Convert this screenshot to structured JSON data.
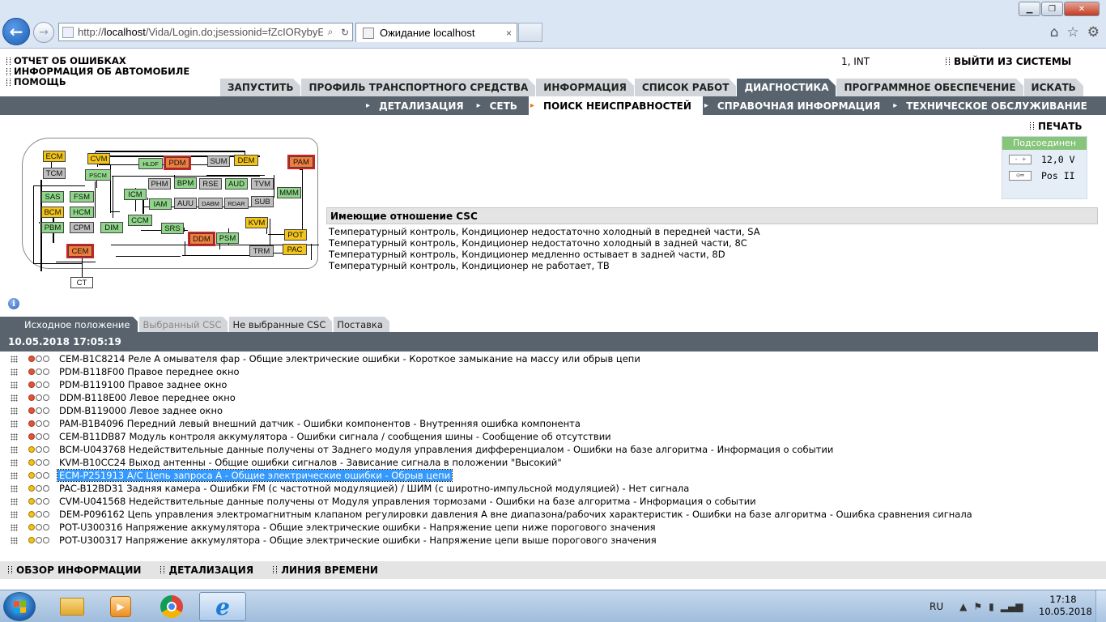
{
  "browser": {
    "url_prefix": "http://",
    "url_host": "localhost",
    "url_rest": "/Vida/Login.do;jsessionid=fZcIORybyE",
    "tab_title": "Ожидание localhost",
    "tab_close": "×"
  },
  "header": {
    "links": [
      "ОТЧЕТ ОБ ОШИБКАХ",
      "ИНФОРМАЦИЯ ОБ АВТОМОБИЛЕ",
      "ПОМОЩЬ"
    ],
    "user": "1, INT",
    "logout": "ВЫЙТИ ИЗ СИСТЕМЫ"
  },
  "main_tabs": [
    {
      "label": "ЗАПУСТИТЬ",
      "active": false
    },
    {
      "label": "ПРОФИЛЬ ТРАНСПОРТНОГО СРЕДСТВА",
      "active": false
    },
    {
      "label": "ИНФОРМАЦИЯ",
      "active": false
    },
    {
      "label": "СПИСОК РАБОТ",
      "active": false
    },
    {
      "label": "ДИАГНОСТИКА",
      "active": true
    },
    {
      "label": "ПРОГРАММНОЕ ОБЕСПЕЧЕНИЕ",
      "active": false
    },
    {
      "label": "ИСКАТЬ",
      "active": false
    }
  ],
  "sub_tabs": [
    {
      "label": "ДЕТАЛИЗАЦИЯ",
      "active": false
    },
    {
      "label": "СЕТЬ",
      "active": false
    },
    {
      "label": "ПОИСК НЕИСПРАВНОСТЕЙ",
      "active": true
    },
    {
      "label": "СПРАВОЧНАЯ ИНФОРМАЦИЯ",
      "active": false
    },
    {
      "label": "ТЕХНИЧЕСКОЕ ОБСЛУЖИВАНИЕ",
      "active": false
    }
  ],
  "print_label": "ПЕЧАТЬ",
  "status": {
    "header": "Подсоединен",
    "voltage": "12,0 V",
    "position": "Pos II",
    "status_color": "#86c57a"
  },
  "diagram": {
    "nodes": [
      {
        "label": "ECM",
        "color": "yellow"
      },
      {
        "label": "TCM",
        "color": "gray"
      },
      {
        "label": "CVM",
        "color": "yellow"
      },
      {
        "label": "PSCM",
        "color": "green"
      },
      {
        "label": "HLDF",
        "color": "green"
      },
      {
        "label": "PDM",
        "color": "red"
      },
      {
        "label": "SUM",
        "color": "gray"
      },
      {
        "label": "DEM",
        "color": "yellow"
      },
      {
        "label": "PAM",
        "color": "red"
      },
      {
        "label": "SAS",
        "color": "green"
      },
      {
        "label": "FSM",
        "color": "green"
      },
      {
        "label": "BCM",
        "color": "yellow"
      },
      {
        "label": "HCM",
        "color": "green"
      },
      {
        "label": "PBM",
        "color": "green"
      },
      {
        "label": "CPM",
        "color": "gray"
      },
      {
        "label": "ICM",
        "color": "green"
      },
      {
        "label": "PHM",
        "color": "gray"
      },
      {
        "label": "BPM",
        "color": "green"
      },
      {
        "label": "RSE",
        "color": "gray"
      },
      {
        "label": "AUD",
        "color": "green"
      },
      {
        "label": "TVM",
        "color": "gray"
      },
      {
        "label": "MMM",
        "color": "green"
      },
      {
        "label": "IAM",
        "color": "green"
      },
      {
        "label": "AUU",
        "color": "gray"
      },
      {
        "label": "DABM",
        "color": "gray"
      },
      {
        "label": "RDAR",
        "color": "gray"
      },
      {
        "label": "SUB",
        "color": "gray"
      },
      {
        "label": "DIM",
        "color": "green"
      },
      {
        "label": "CCM",
        "color": "green"
      },
      {
        "label": "SRS",
        "color": "green"
      },
      {
        "label": "KVM",
        "color": "yellow"
      },
      {
        "label": "POT",
        "color": "yellow"
      },
      {
        "label": "DDM",
        "color": "red"
      },
      {
        "label": "PSM",
        "color": "green"
      },
      {
        "label": "CEM",
        "color": "red"
      },
      {
        "label": "TRM",
        "color": "gray"
      },
      {
        "label": "PAC",
        "color": "yellow"
      },
      {
        "label": "CT",
        "color": "white"
      }
    ]
  },
  "csc": {
    "title": "Имеющие отношение CSC",
    "items": [
      "Температурный контроль, Кондиционер недостаточно холодный в передней части, SA",
      "Температурный контроль, Кондиционер недостаточно холодный в задней части, 8C",
      "Температурный контроль, Кондиционер медленно остывает в задней части, 8D",
      "Температурный контроль, Кондиционер не работает, TB"
    ]
  },
  "result_tabs": [
    {
      "label": "Исходное положение",
      "state": "active"
    },
    {
      "label": "Выбранный CSC",
      "state": "dim"
    },
    {
      "label": "Не выбранные CSC",
      "state": "normal"
    },
    {
      "label": "Поставка",
      "state": "normal"
    }
  ],
  "timestamp": "10.05.2018 17:05:19",
  "dtcs": [
    {
      "lamp": "red",
      "text": "CEM-B1C8214 Реле А омывателя фар - Общие электрические ошибки - Короткое замыкание на массу или обрыв цепи"
    },
    {
      "lamp": "red",
      "text": "PDM-B118F00 Правое переднее окно"
    },
    {
      "lamp": "red",
      "text": "PDM-B119100 Правое заднее окно"
    },
    {
      "lamp": "red",
      "text": "DDM-B118E00 Левое переднее окно"
    },
    {
      "lamp": "red",
      "text": "DDM-B119000 Левое заднее окно"
    },
    {
      "lamp": "red",
      "text": "PAM-B1B4096 Передний левый внешний датчик - Ошибки компонентов - Внутренняя ошибка компонента"
    },
    {
      "lamp": "red",
      "text": "CEM-B11DB87 Модуль контроля аккумулятора - Ошибки сигнала / сообщения шины - Сообщение об отсутствии"
    },
    {
      "lamp": "yellow",
      "text": "BCM-U043768 Недействительные данные получены от Заднего модуля управления дифференциалом - Ошибки на базе алгоритма - Информация о событии"
    },
    {
      "lamp": "yellow",
      "text": "KVM-B10CC24 Выход антенны - Общие ошибки сигналов - Зависание сигнала в положении \"Высокий\""
    },
    {
      "lamp": "yellow",
      "text": "ECM-P251913 A/C Цепь запроса A - Общие электрические ошибки - Обрыв цепи",
      "selected": true
    },
    {
      "lamp": "yellow",
      "text": "PAC-B12BD31 Задняя камера - Ошибки FM (с частотной модуляцией) / ШИМ (с широтно-импульсной модуляцией) - Нет сигнала"
    },
    {
      "lamp": "yellow",
      "text": "CVM-U041568 Недействительные данные получены от Модуля управления тормозами - Ошибки на базе алгоритма - Информация о событии"
    },
    {
      "lamp": "yellow",
      "text": "DEM-P096162 Цепь управления электромагнитным клапаном регулировки давления A вне диапазона/рабочих характеристик - Ошибки на базе алгоритма - Ошибка сравнения сигнала"
    },
    {
      "lamp": "yellow",
      "text": "POT-U300316 Напряжение аккумулятора - Общие электрические ошибки - Напряжение цепи ниже порогового значения"
    },
    {
      "lamp": "yellow",
      "text": "POT-U300317 Напряжение аккумулятора - Общие электрические ошибки - Напряжение цепи выше порогового значения"
    }
  ],
  "bottom_nav": [
    "ОБЗОР ИНФОРМАЦИИ",
    "ДЕТАЛИЗАЦИЯ",
    "ЛИНИЯ ВРЕМЕНИ"
  ],
  "taskbar": {
    "lang": "RU",
    "time": "17:18",
    "date": "10.05.2018"
  }
}
